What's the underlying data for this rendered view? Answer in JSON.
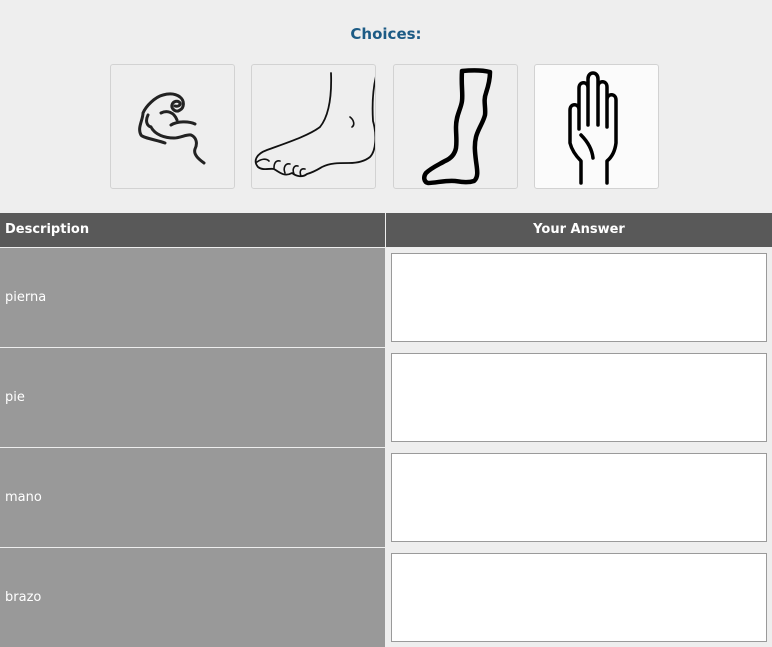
{
  "choices": {
    "title": "Choices:",
    "items": [
      {
        "icon": "flexed-arm-icon"
      },
      {
        "icon": "foot-icon"
      },
      {
        "icon": "leg-icon"
      },
      {
        "icon": "hand-icon"
      }
    ]
  },
  "table": {
    "headers": {
      "description": "Description",
      "answer": "Your Answer"
    },
    "rows": [
      {
        "description": "pierna",
        "answer": ""
      },
      {
        "description": "pie",
        "answer": ""
      },
      {
        "description": "mano",
        "answer": ""
      },
      {
        "description": "brazo",
        "answer": ""
      }
    ]
  },
  "colors": {
    "title": "#1c5b85",
    "header_bg": "#595959",
    "description_bg": "#999999",
    "page_bg": "#eeeeee"
  }
}
